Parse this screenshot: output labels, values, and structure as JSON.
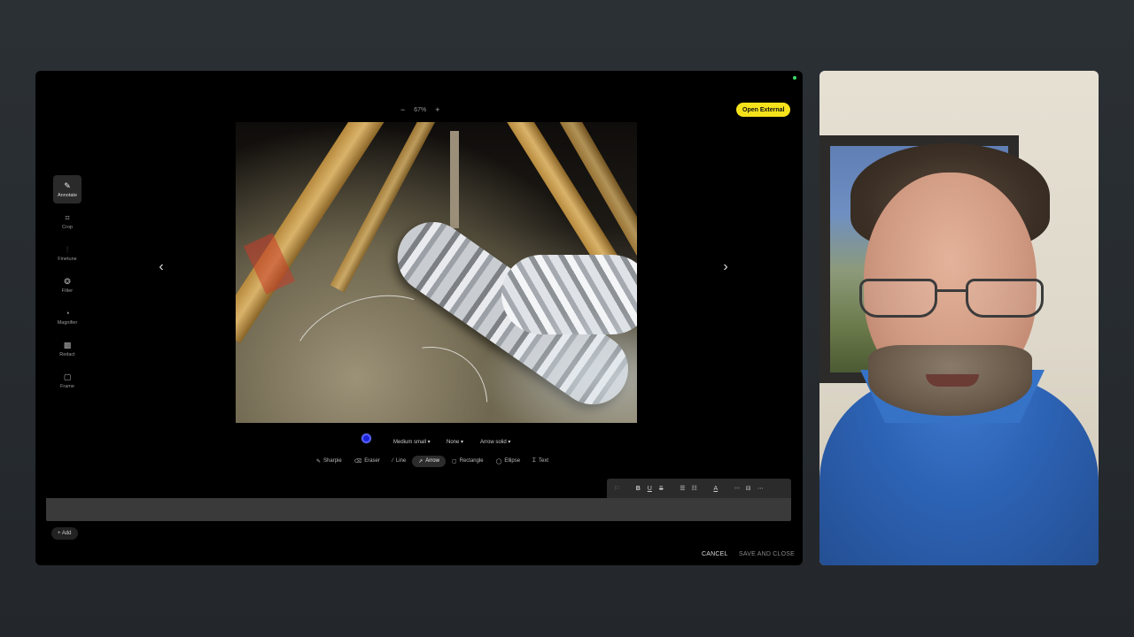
{
  "zoom": {
    "out_label": "−",
    "level": "67%",
    "in_label": "+"
  },
  "open_external_label": "Open External",
  "tools": [
    {
      "label": "Annotate",
      "icon": "✎"
    },
    {
      "label": "Crop",
      "icon": "⌗"
    },
    {
      "label": "Finetune",
      "icon": "⫶"
    },
    {
      "label": "Filter",
      "icon": "❂"
    },
    {
      "label": "Magnifier",
      "icon": "◔"
    },
    {
      "label": "Redact",
      "icon": "▩"
    },
    {
      "label": "Frame",
      "icon": "▢"
    }
  ],
  "nav": {
    "prev": "‹",
    "next": "›"
  },
  "options": {
    "line_width_value": "Medium small ▾",
    "start_value": "None ▾",
    "end_value": "Arrow solid ▾",
    "swatch_color": "#1c22d8"
  },
  "draw_tools": [
    {
      "label": "Sharpie",
      "icon": "✎"
    },
    {
      "label": "Eraser",
      "icon": "⌫"
    },
    {
      "label": "Line",
      "icon": "⁄"
    },
    {
      "label": "Arrow",
      "icon": "↗"
    },
    {
      "label": "Rectangle",
      "icon": "▢"
    },
    {
      "label": "Ellipse",
      "icon": "◯"
    },
    {
      "label": "Text",
      "icon": "Ꮖ"
    }
  ],
  "format_bar": {
    "flag": "⚐",
    "bold": "B",
    "underline": "U",
    "strike": "S",
    "bullets": "☰",
    "numbered": "☷",
    "text_color": "A",
    "link": "⚯",
    "align": "⊟",
    "more": "⋯"
  },
  "comment_value": "",
  "add_label": "+ Add",
  "cancel_label": "CANCEL",
  "save_label": "SAVE AND CLOSE",
  "colors": {
    "accent_yellow": "#f5e21b",
    "status_green": "#3ddc6b"
  }
}
